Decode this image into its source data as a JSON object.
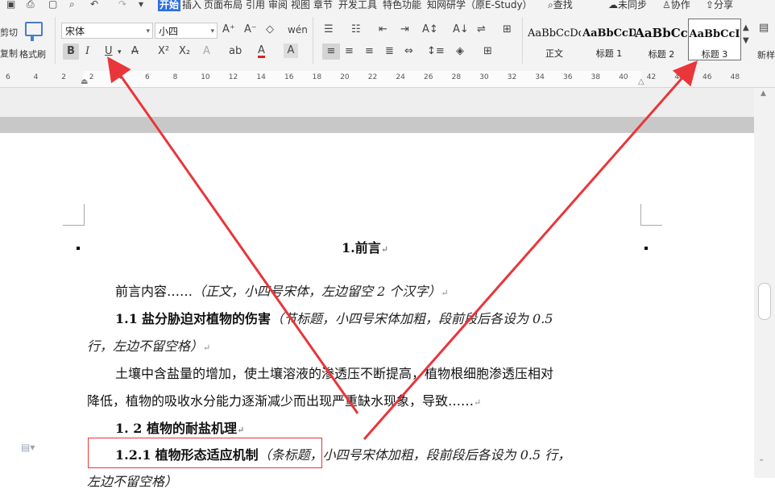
{
  "menu": {
    "tabs": [
      "开始",
      "插入",
      "页面布局",
      "引用",
      "审阅",
      "视图",
      "章节",
      "开发工具",
      "特色功能",
      "知网研学（原E-Study）"
    ],
    "active_tab": "开始",
    "right_items": [
      "查找",
      "未同步",
      "协作",
      "分享"
    ]
  },
  "ribbon": {
    "clipboard": {
      "cut_label": "剪切",
      "copy_label": "复制",
      "format_painter_label": "格式刷"
    },
    "font_name": "宋体",
    "font_size": "小四",
    "style_gallery": [
      {
        "sample": "AaBbCcDd",
        "label": "正文"
      },
      {
        "sample": "AaBbCcD",
        "label": "标题 1"
      },
      {
        "sample": "AaBbCc",
        "label": "标题 2"
      },
      {
        "sample": "AaBbCcI",
        "label": "标题 3",
        "selected": true
      }
    ],
    "new_style_label": "新样"
  },
  "ruler": {
    "ticks": [
      "6",
      "4",
      "2",
      "2",
      "4",
      "6",
      "8",
      "10",
      "12",
      "14",
      "16",
      "18",
      "20",
      "22",
      "24",
      "26",
      "28",
      "30",
      "32",
      "34",
      "36",
      "38",
      "40",
      "42",
      "44",
      "46",
      "48"
    ]
  },
  "document": {
    "title": "1.前言",
    "para_intro": "前言内容……",
    "para_intro_note": "（正文，小四号宋体，左边留空 2 个汉字）",
    "h11_num": "1.1",
    "h11_text": "盐分胁迫对植物的伤害",
    "h11_note_line1": "（节标题，小四号宋体加粗，段前段后各设为 0.5",
    "h11_note_line2": "行，左边不留空格）",
    "body_line1": "土壤中含盐量的增加，使土壤溶液的渗透压不断提高，植物根细胞渗透压相对",
    "body_line2": "降低，植物的吸收水分能力逐渐减少而出现严重缺水现象，导致……",
    "h12_text": "1. 2 植物的耐盐机理",
    "h121_num": "1.2.1",
    "h121_text": "植物形态适应机制",
    "h121_note_line1": "（条标题，小四号宋体加粗，段前段后各设为 0.5 行，",
    "h121_note_line2": "左边不留空格）",
    "para_mark": "↵"
  },
  "colors": {
    "annotation_red": "#e8363a",
    "active_tab_bg": "#2f6fdc"
  }
}
